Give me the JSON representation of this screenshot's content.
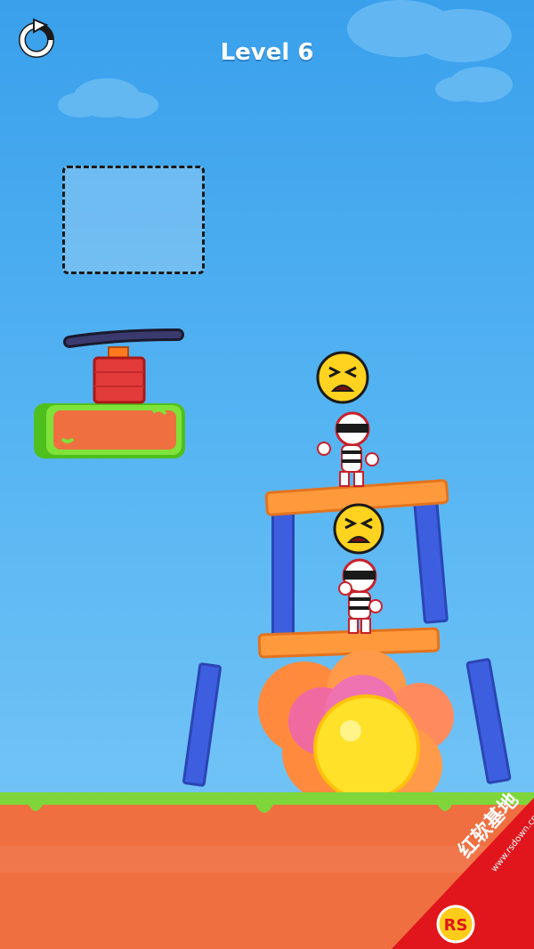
{
  "hud": {
    "level_label": "Level 6",
    "restart_icon": "restart-arrow-icon"
  },
  "draw_zone": {
    "icon": "dashed-draw-area"
  },
  "scene": {
    "enemies": [
      {
        "face": "angry-emoji-face",
        "pose": "standing-top"
      },
      {
        "face": "angry-emoji-face",
        "pose": "standing-middle"
      }
    ],
    "bomb": "tnt-plunger-icon",
    "explosion": "explosion-burst"
  },
  "watermark": {
    "brand_text": "红软基地",
    "url_text": "www.rsdown.cn"
  },
  "colors": {
    "sky": "#4aa9ef",
    "grass": "#7ed63a",
    "ground": "#f06f40",
    "plank": "#ff9a3c",
    "pillar": "#3d5fdf",
    "tnt": "#e33a3a",
    "watermark_red": "#e0161c"
  }
}
